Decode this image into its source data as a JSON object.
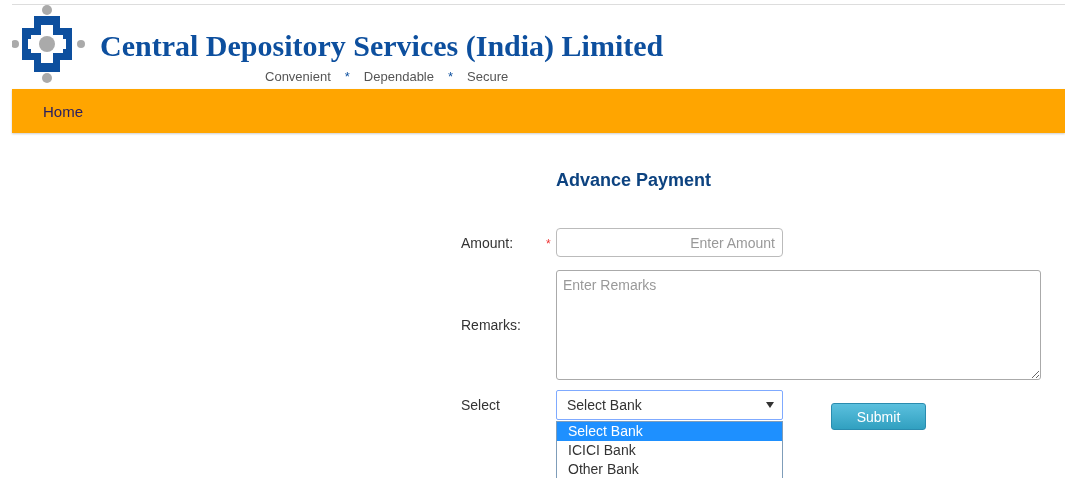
{
  "header": {
    "title": "Central Depository Services (India) Limited",
    "tagline": [
      {
        "kind": "word",
        "text": "Convenient"
      },
      {
        "kind": "separator",
        "text": "*"
      },
      {
        "kind": "word",
        "text": "Dependable"
      },
      {
        "kind": "separator",
        "text": "*"
      },
      {
        "kind": "word",
        "text": "Secure"
      }
    ]
  },
  "nav": [
    {
      "label": "Home"
    }
  ],
  "form": {
    "heading": "Advance Payment",
    "amount": {
      "label": "Amount:",
      "required": true,
      "placeholder": "Enter Amount"
    },
    "remarks": {
      "label": "Remarks:",
      "placeholder": "Enter Remarks"
    },
    "bank": {
      "label": "Select",
      "value": "Select Bank",
      "expanded": true,
      "options": [
        {
          "label": "Select Bank",
          "selected": true
        },
        {
          "label": "ICICI Bank",
          "selected": false
        },
        {
          "label": "Other Bank",
          "selected": false
        }
      ]
    },
    "submit": "Submit"
  }
}
